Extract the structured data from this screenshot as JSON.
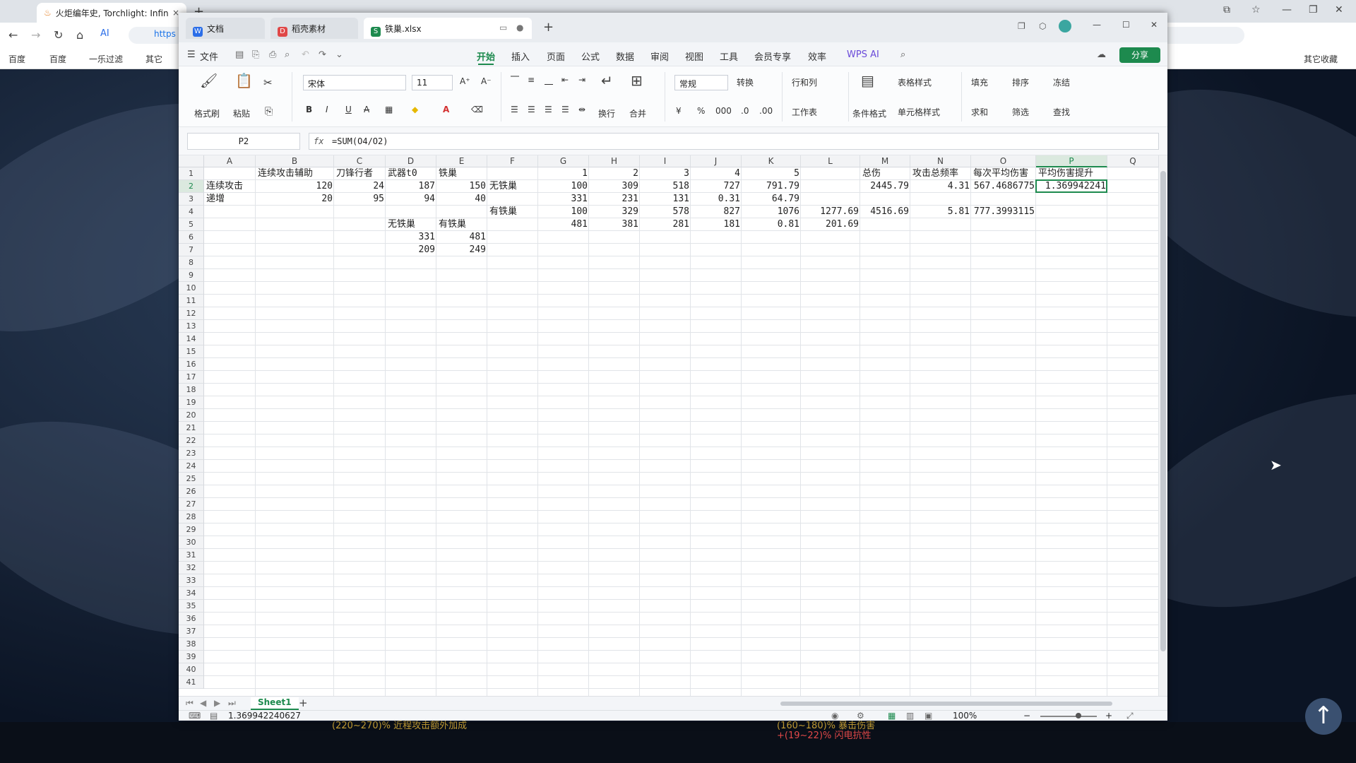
{
  "browser": {
    "tab_title": "火炬编年史, Torchlight: Infin",
    "tab_close": "×",
    "new_tab": "+",
    "address_text": "https",
    "bookmarks": [
      "百度",
      "百度",
      "一乐过滤",
      "其它",
      "其它收藏"
    ]
  },
  "wps": {
    "doc_tabs": [
      {
        "label": "文档",
        "icon": "W",
        "color": "#2b6ee8"
      },
      {
        "label": "稻壳素材",
        "icon": "D",
        "color": "#e04848"
      },
      {
        "label": "铁巢.xlsx",
        "icon": "S",
        "color": "#1d8a4e"
      }
    ],
    "file_menu": "文件",
    "menu": [
      "开始",
      "插入",
      "页面",
      "公式",
      "数据",
      "审阅",
      "视图",
      "工具",
      "会员专享",
      "效率"
    ],
    "active_menu": "开始",
    "wps_ai": "WPS AI",
    "share": "分享",
    "ribbon": {
      "format_painter": "格式刷",
      "paste": "粘贴",
      "font_name": "宋体",
      "font_size": "11",
      "wrap": "换行",
      "merge": "合并",
      "number_format": "常规",
      "convert": "转换",
      "rows_cols": "行和列",
      "worksheet": "工作表",
      "conditional_format": "条件格式",
      "table_style": "表格样式",
      "cell_style": "单元格样式",
      "fill": "填充",
      "sort": "排序",
      "freeze": "冻结",
      "sum": "求和",
      "filter": "筛选",
      "find": "查找",
      "currency": "¥",
      "percent": "%"
    },
    "name_box": "P2",
    "formula": "=SUM(O4/O2)",
    "fx": "fx",
    "columns": [
      "A",
      "B",
      "C",
      "D",
      "E",
      "F",
      "G",
      "H",
      "I",
      "J",
      "K",
      "L",
      "M",
      "N",
      "O",
      "P",
      "Q"
    ],
    "selected_column": "P",
    "selected_row": "2",
    "rows": [
      "1",
      "2",
      "3",
      "4",
      "5",
      "6",
      "7",
      "8",
      "9",
      "10",
      "11",
      "12",
      "13",
      "14",
      "15",
      "16",
      "17",
      "18",
      "19",
      "20",
      "21",
      "22",
      "23",
      "24",
      "25",
      "26",
      "27",
      "28",
      "29",
      "30",
      "31",
      "32",
      "33",
      "34",
      "35",
      "36",
      "37",
      "38",
      "39",
      "40",
      "41"
    ],
    "cells": {
      "B1": "连续攻击辅助",
      "C1": "刀锋行者",
      "D1": "武器t0",
      "E1": "铁巢",
      "G1": "1",
      "H1": "2",
      "I1": "3",
      "J1": "4",
      "K1": "5",
      "M1": "总伤",
      "N1": "攻击总频率",
      "O1": "每次平均伤害",
      "P1": "平均伤害提升",
      "A2": "连续攻击",
      "B2": "120",
      "C2": "24",
      "D2": "187",
      "E2": "150",
      "F2": "无铁巢",
      "G2": "100",
      "H2": "309",
      "I2": "518",
      "J2": "727",
      "K2": "791.79",
      "M2": "2445.79",
      "N2": "4.31",
      "O2": "567.4686775",
      "P2": "1.369942241",
      "A3": "递增",
      "B3": "20",
      "C3": "95",
      "D3": "94",
      "E3": "40",
      "G3": "331",
      "H3": "231",
      "I3": "131",
      "J3": "0.31",
      "K3": "64.79",
      "F4": "有铁巢",
      "G4": "100",
      "H4": "329",
      "I4": "578",
      "J4": "827",
      "K4": "1076",
      "L4": "1277.69",
      "M4": "4516.69",
      "N4": "5.81",
      "O4": "777.3993115",
      "D5": "无铁巢",
      "E5": "有铁巢",
      "G5": "481",
      "H5": "381",
      "I5": "281",
      "J5": "181",
      "K5": "0.81",
      "L5": "201.69",
      "D6": "331",
      "E6": "481",
      "D7": "209",
      "E7": "249"
    },
    "sheet_tab": "Sheet1",
    "status_value": "1.369942240627",
    "zoom": "100%"
  },
  "background": {
    "line1": "(220~270)% 近程攻击额外加成",
    "line2": "+(19~22)% 闪电抗性",
    "line3": "(160~180)% 暴击伤害"
  },
  "colors": {
    "accent": "#1d8a4e",
    "selection": "#1d8a4e"
  }
}
